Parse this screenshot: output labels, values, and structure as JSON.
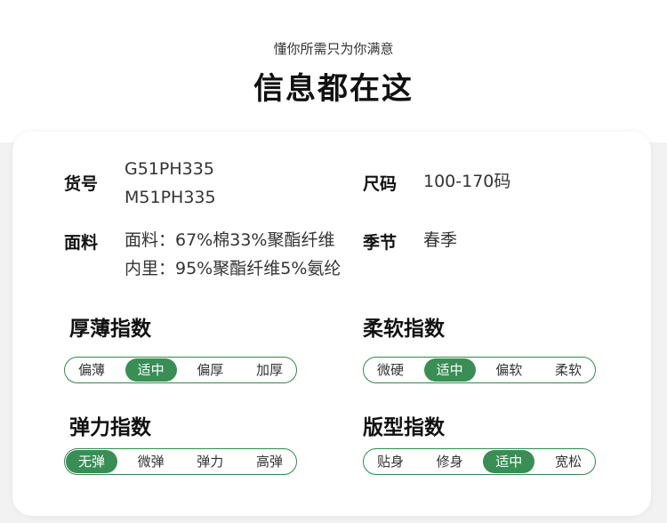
{
  "header": {
    "subtitle": "懂你所需只为你满意",
    "title": "信息都在这"
  },
  "info": {
    "sku_label": "货号",
    "sku_values": [
      "G51PH335",
      "M51PH335"
    ],
    "size_label": "尺码",
    "size_value": "100-170码",
    "fabric_label": "面料",
    "fabric_values": [
      "面料：67%棉33%聚酯纤维",
      "内里：95%聚酯纤维5%氨纶"
    ],
    "season_label": "季节",
    "season_value": "春季"
  },
  "indices": {
    "thickness": {
      "title": "厚薄指数",
      "options": [
        "偏薄",
        "适中",
        "偏厚",
        "加厚"
      ],
      "selected": "适中"
    },
    "softness": {
      "title": "柔软指数",
      "options": [
        "微硬",
        "适中",
        "偏软",
        "柔软"
      ],
      "selected": "适中"
    },
    "elasticity": {
      "title": "弹力指数",
      "options": [
        "无弹",
        "微弹",
        "弹力",
        "高弹"
      ],
      "selected": "无弹"
    },
    "fit": {
      "title": "版型指数",
      "options": [
        "贴身",
        "修身",
        "适中",
        "宽松"
      ],
      "selected": "适中"
    }
  },
  "colors": {
    "accent": "#388e54",
    "border": "#2f8a4c"
  }
}
